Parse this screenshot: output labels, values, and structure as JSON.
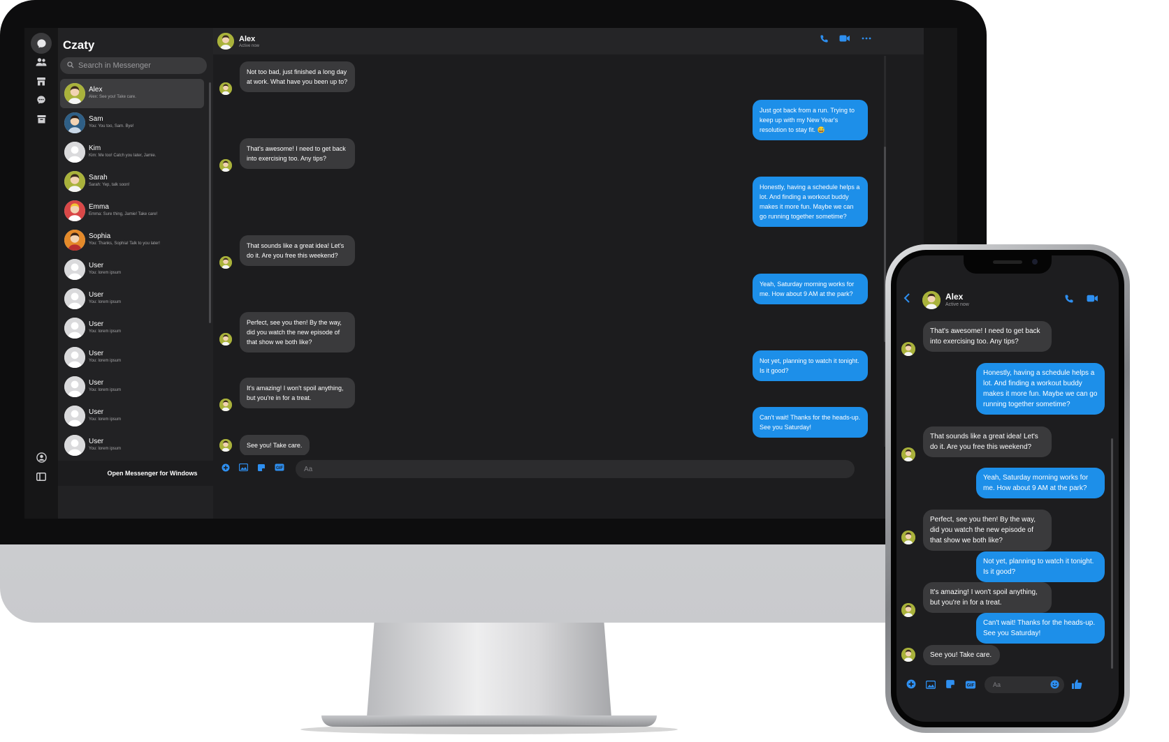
{
  "desktop": {
    "app_title": "Czaty",
    "search_placeholder": "Search in Messenger",
    "footer_label": "Open Messenger for Windows",
    "chats": [
      {
        "name": "Alex",
        "preview": "Alex: See you! Take care.",
        "selected": true,
        "avatar": "green"
      },
      {
        "name": "Sam",
        "preview": "You: You too, Sam. Bye!",
        "avatar": "blue"
      },
      {
        "name": "Kim",
        "preview": "Kim: Me too! Catch you later, Jamie.",
        "avatar": "grey"
      },
      {
        "name": "Sarah",
        "preview": "Sarah: Yep, talk soon!",
        "avatar": "green"
      },
      {
        "name": "Emma",
        "preview": "Emma: Sure thing, Jamie! Take care!",
        "avatar": "red"
      },
      {
        "name": "Sophia",
        "preview": "You: Thanks, Sophia! Talk to you later!",
        "avatar": "orange"
      },
      {
        "name": "User",
        "preview": "You: lorem ipsum",
        "avatar": "grey"
      },
      {
        "name": "User",
        "preview": "You: lorem ipsum",
        "avatar": "grey"
      },
      {
        "name": "User",
        "preview": "You: lorem ipsum",
        "avatar": "grey"
      },
      {
        "name": "User",
        "preview": "You: lorem ipsum",
        "avatar": "grey"
      },
      {
        "name": "User",
        "preview": "You: lorem ipsum",
        "avatar": "grey"
      },
      {
        "name": "User",
        "preview": "You: lorem ipsum",
        "avatar": "grey"
      },
      {
        "name": "User",
        "preview": "You: lorem ipsum",
        "avatar": "grey"
      }
    ],
    "conversation": {
      "contact_name": "Alex",
      "contact_status": "Active now",
      "composer_placeholder": "Aa",
      "messages": [
        {
          "side": "in",
          "text": "Not too bad, just finished a long day at work. What have you been up to?"
        },
        {
          "side": "out",
          "text": "Just got back from a run. Trying to keep up with my New Year's resolution to stay fit. 😅"
        },
        {
          "side": "in",
          "text": "That's awesome! I need to get back into exercising too. Any tips?"
        },
        {
          "side": "out",
          "text": "Honestly, having a schedule helps a lot. And finding a workout buddy makes it more fun. Maybe we can go running together sometime?"
        },
        {
          "side": "in",
          "text": "That sounds like a great idea! Let's do it. Are you free this weekend?"
        },
        {
          "side": "out",
          "text": "Yeah, Saturday morning works for me. How about 9 AM at the park?"
        },
        {
          "side": "in",
          "text": "Perfect, see you then! By the way, did you watch the new episode of that show we both like?"
        },
        {
          "side": "out",
          "text": "Not yet, planning to watch it tonight. Is it good?"
        },
        {
          "side": "in",
          "text": "It's amazing! I won't spoil anything, but you're in for a treat."
        },
        {
          "side": "out",
          "text": "Can't wait! Thanks for the heads-up. See you Saturday!"
        },
        {
          "side": "in",
          "text": "See you! Take care."
        }
      ]
    }
  },
  "mobile": {
    "contact_name": "Alex",
    "contact_status": "Active now",
    "composer_placeholder": "Aa",
    "messages": [
      {
        "side": "in",
        "text": "That's awesome! I need to get back into exercising too. Any tips?"
      },
      {
        "side": "out",
        "text": "Honestly, having a schedule helps a lot. And finding a workout buddy makes it more fun. Maybe we can go running together sometime?"
      },
      {
        "side": "in",
        "text": "That sounds like a great idea! Let's do it. Are you free this weekend?"
      },
      {
        "side": "out",
        "text": "Yeah, Saturday morning works for me. How about 9 AM at the park?"
      },
      {
        "side": "in",
        "text": "Perfect, see you then! By the way, did you watch the new episode of that show we both like?"
      },
      {
        "side": "out",
        "text": "Not yet, planning to watch it tonight. Is it good?"
      },
      {
        "side": "in",
        "text": "It's amazing! I won't spoil anything, but you're in for a treat."
      },
      {
        "side": "out",
        "text": "Can't wait! Thanks for the heads-up. See you Saturday!"
      },
      {
        "side": "in",
        "text": "See you! Take care."
      }
    ]
  },
  "colors": {
    "accent": "#2e8ff0",
    "outgoing_bubble": "#1d8fe9",
    "incoming_bubble": "#3a3a3c",
    "background": "#1c1c1e"
  },
  "icons": [
    "chat-bubble-icon",
    "people-icon",
    "store-icon",
    "message-request-icon",
    "archive-icon",
    "account-icon",
    "sidebar-toggle-icon",
    "compose-icon",
    "search-icon",
    "phone-icon",
    "video-icon",
    "more-icon",
    "plus-icon",
    "image-icon",
    "sticker-icon",
    "gif-icon",
    "back-icon",
    "emoji-icon",
    "like-icon"
  ]
}
